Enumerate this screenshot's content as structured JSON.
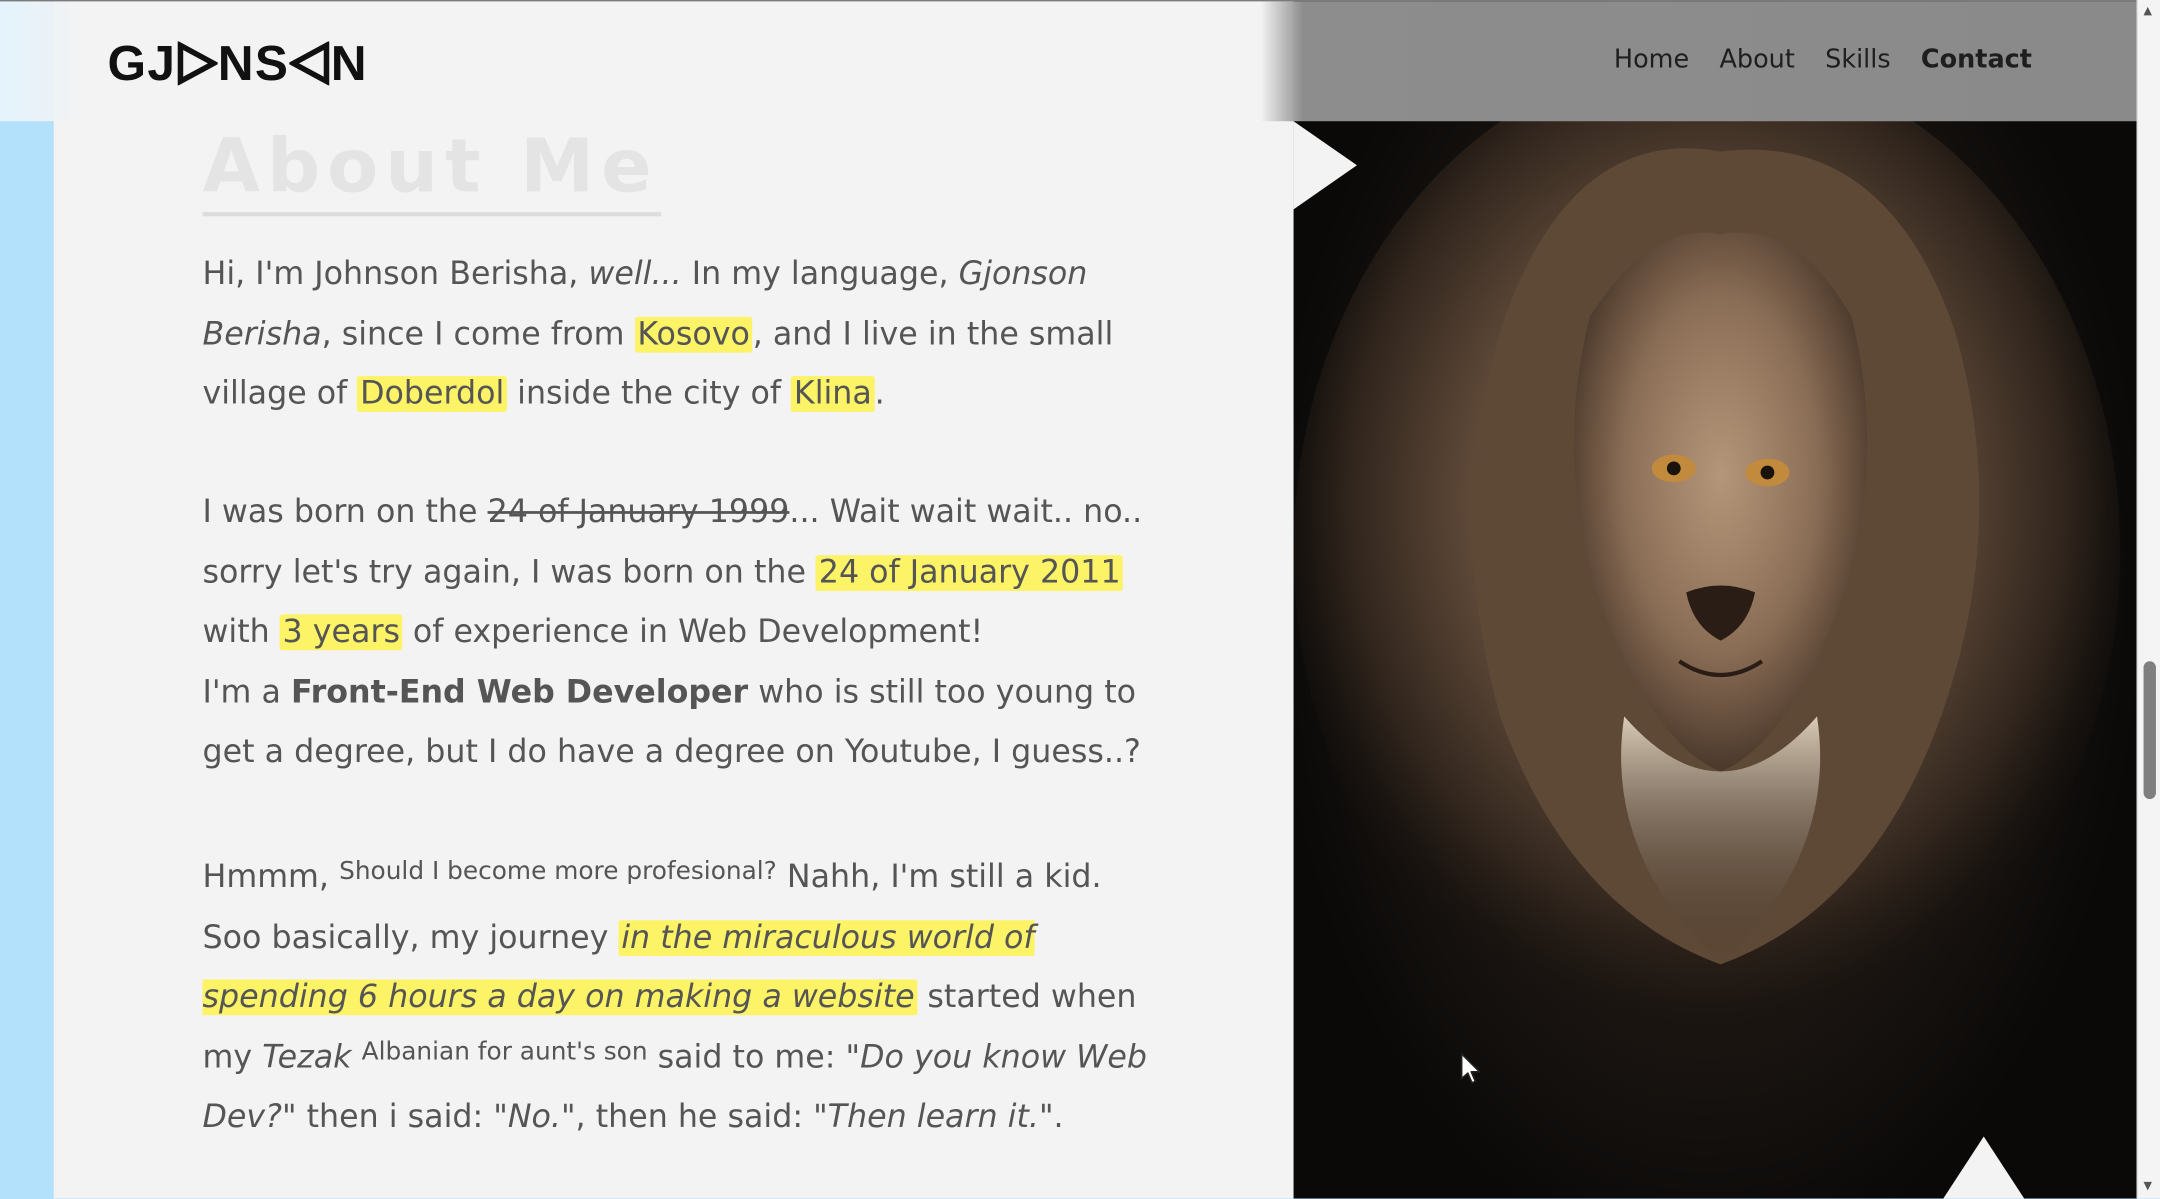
{
  "header": {
    "logo": "GJONSON",
    "nav": [
      "Home",
      "About",
      "Skills",
      "Contact"
    ],
    "active_nav": "Contact"
  },
  "about": {
    "title": "About Me",
    "p1": {
      "a": "Hi, I'm Johnson Berisha, ",
      "b": "well...",
      "c": " In my language, ",
      "d": "Gjonson Berisha",
      "e": ", since I come from ",
      "f": "Kosovo",
      "g": ", and I live in the small village of ",
      "h": "Doberdol",
      "i": " inside the city of ",
      "j": "Klina",
      "k": "."
    },
    "p2": {
      "a": "I was born on the ",
      "b": "24 of January 1999",
      "c": "... Wait wait wait.. no.. sorry let's try again, I was born on the ",
      "d": "24 of January 2011",
      "e": " with ",
      "f": "3 years",
      "g": " of experience in Web Development!"
    },
    "p3": {
      "a": "I'm a ",
      "b": "Front-End Web Developer",
      "c": " who is still too young to get a degree, but I do have a degree on Youtube, I guess..?"
    },
    "p4": {
      "a": "Hmmm, ",
      "b": "Should I become more profesional?",
      "c": " Nahh, I'm still a kid. Soo basically, my journey ",
      "d": "in the miraculous world of spending 6 hours a day on making a website",
      "e": " started when my ",
      "f": "Tezak",
      "g": "Albanian for aunt's son",
      "h": " said to me: \"",
      "i": "Do you know Web Dev?",
      "j": "\" then i said: \"",
      "k": "No.",
      "l": "\", then he said: \"",
      "m": "Then learn it.",
      "n": "\"."
    }
  },
  "colors": {
    "highlight": "#fcf366",
    "side_strip": "#b3e0fb",
    "panel": "#f3f3f3",
    "text": "#555555"
  },
  "icons": {
    "cursor": "mouse-pointer-icon",
    "scroll_up": "scroll-up-arrow-icon",
    "scroll_down": "scroll-down-arrow-icon"
  }
}
